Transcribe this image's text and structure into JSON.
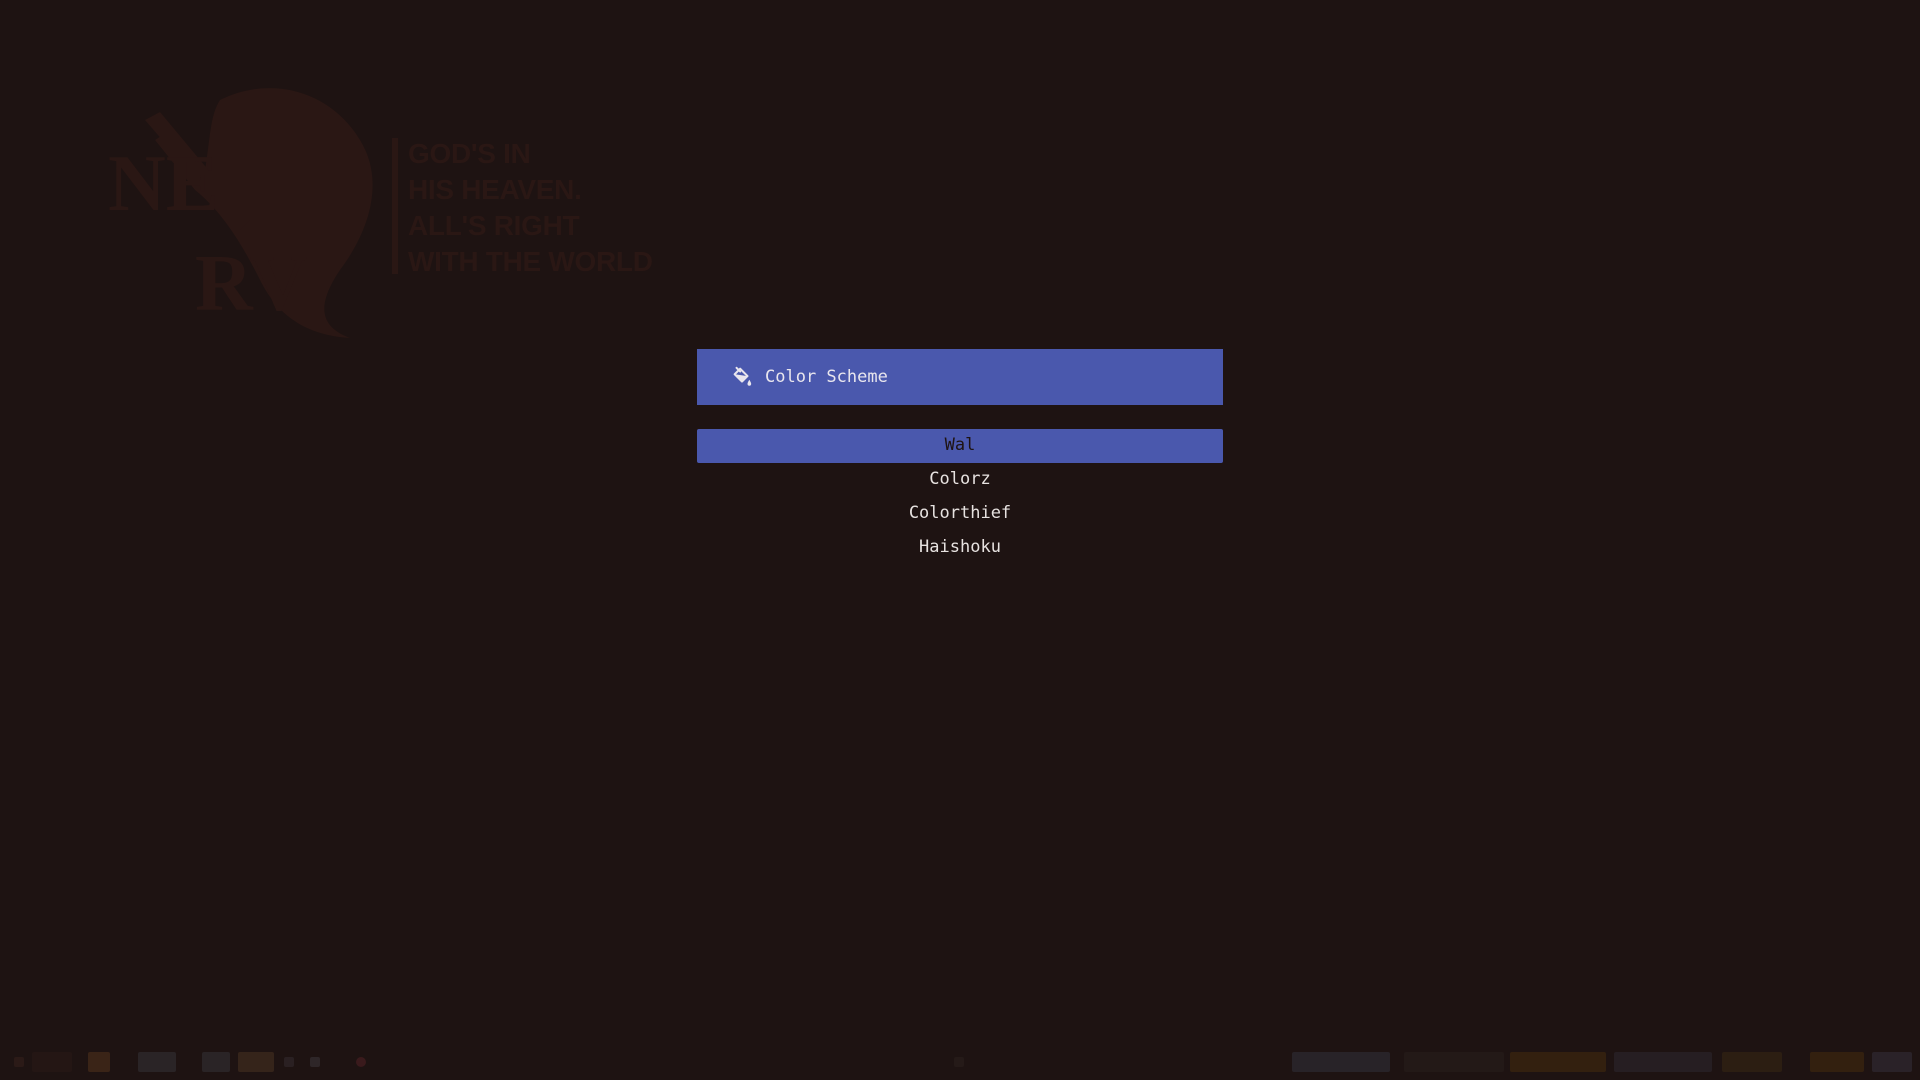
{
  "colors": {
    "background": "#1e1312",
    "accent": "#4a58ad",
    "text": "#e7e2e0",
    "selected_text": "#1e1312",
    "wallpaper_ink": "#2a1714"
  },
  "wallpaper": {
    "logo_text_line1": "NE",
    "logo_text_line2": "RV",
    "motto": [
      "GOD'S IN",
      "HIS HEAVEN.",
      "ALL'S RIGHT",
      "WITH THE WORLD"
    ]
  },
  "menu": {
    "prompt_icon": "paint-bucket-icon",
    "prompt": "Color Scheme",
    "items": [
      {
        "label": "Wal",
        "selected": true
      },
      {
        "label": "Colorz",
        "selected": false
      },
      {
        "label": "Colorthief",
        "selected": false
      },
      {
        "label": "Haishoku",
        "selected": false
      }
    ]
  }
}
